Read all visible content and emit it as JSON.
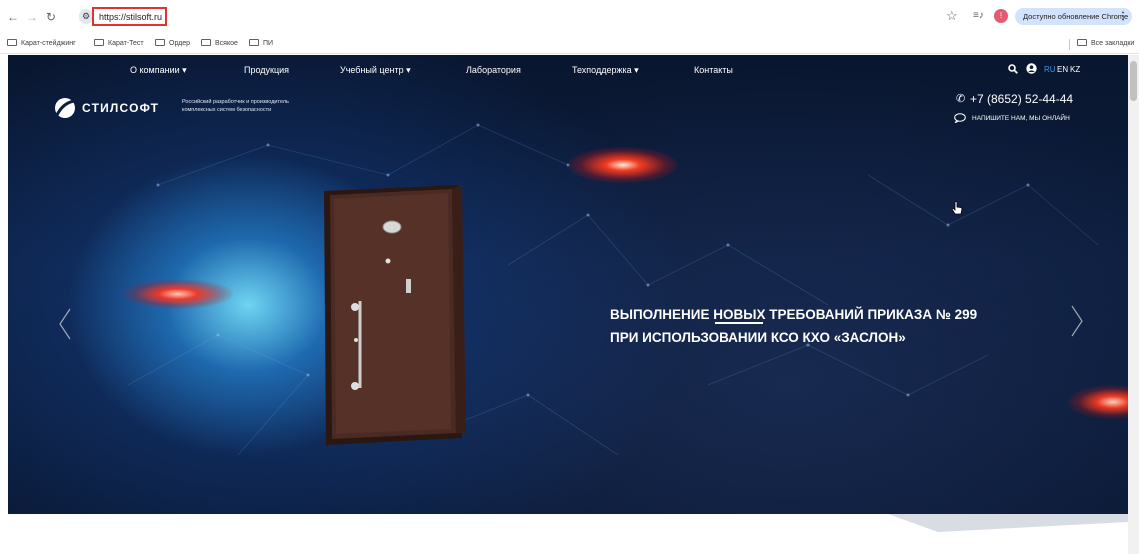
{
  "browser": {
    "url": "https://stilsoft.ru",
    "update_button": "Доступно обновление Chrome",
    "profile_initial": "!",
    "bookmarks": [
      "Карат-стейджинг",
      "Карат-Тест",
      "Ордер",
      "Всякое",
      "ПИ"
    ],
    "all_bookmarks": "Все закладки",
    "icons": [
      "back-icon",
      "forward-icon",
      "reload-icon",
      "site-info-icon",
      "star-icon",
      "media-icon",
      "menu-dots-icon"
    ]
  },
  "menu": {
    "items": [
      "О компании ▾",
      "Продукция",
      "Учебный центр ▾",
      "Лаборатория",
      "Техподдержка ▾",
      "Контакты"
    ],
    "languages": [
      "RU",
      "EN",
      "KZ"
    ],
    "active_language": "RU",
    "accent_color": "#3d8fe0"
  },
  "header": {
    "logo": "СТИЛСОФТ",
    "tagline": [
      "Российский разработчик и производитель",
      "комплексных систем безопасности"
    ],
    "phone": "+7 (8652) 52-44-44",
    "chat_link": "НАПИШИТЕ НАМ, МЫ ОНЛАЙН"
  },
  "slide": {
    "headline_line1_pre": "ВЫПОЛНЕНИЕ ",
    "headline_line1_highlight": "НОВЫХ",
    "headline_line1_post": " ТРЕБОВАНИЙ ПРИКАЗА № 299",
    "headline_line2": "ПРИ ИСПОЛЬЗОВАНИИ КСО КХО «ЗАСЛОН»",
    "background_color": "#0c1d3d",
    "glow_color": "#ff2a1a"
  }
}
